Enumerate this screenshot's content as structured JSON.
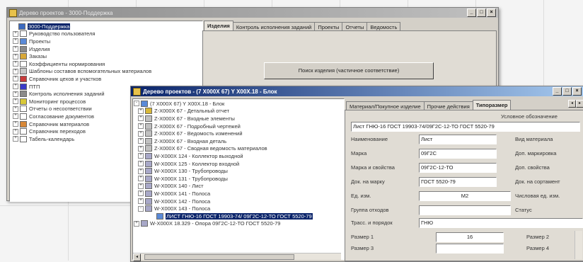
{
  "window1": {
    "title": "Дерево проектов - 3000-Поддержка",
    "buttons": [
      "_",
      "□",
      "×"
    ],
    "tree": [
      {
        "label": "3000-Поддержка",
        "exp": "",
        "icon_color": "#3c6ac0",
        "selected": true
      },
      {
        "label": "Руководство пользователя",
        "exp": "+",
        "icon_color": "#ffffff"
      },
      {
        "label": "Проекты",
        "exp": "+",
        "icon_color": "#5a8ad8"
      },
      {
        "label": "Изделия",
        "exp": "+",
        "icon_color": "#8a8a8a"
      },
      {
        "label": "Заказы",
        "exp": "+",
        "icon_color": "#d8a838"
      },
      {
        "label": "Коэффициенты нормирования",
        "exp": "+",
        "icon_color": "#ffffff"
      },
      {
        "label": "Шаблоны составов вспомогательных материалов",
        "exp": "+",
        "icon_color": "#c8c8c8"
      },
      {
        "label": "Справочник цехов и участков",
        "exp": "+",
        "icon_color": "#c83a3a"
      },
      {
        "label": "ПТП",
        "exp": "+",
        "icon_color": "#3a3ac8"
      },
      {
        "label": "Контроль исполнения заданий",
        "exp": "+",
        "icon_color": "#8a8a8a"
      },
      {
        "label": "Мониторинг процессов",
        "exp": "+",
        "icon_color": "#d8c838"
      },
      {
        "label": "Отчеты о несоответствии",
        "exp": "+",
        "icon_color": "#ffffff"
      },
      {
        "label": "Согласование документов",
        "exp": "+",
        "icon_color": "#ffffff"
      },
      {
        "label": "Справочник материалов",
        "exp": "+",
        "icon_color": "#d88838"
      },
      {
        "label": "Справочник переходов",
        "exp": "+",
        "icon_color": "#ffffff"
      },
      {
        "label": "Табель-календарь",
        "exp": "+",
        "icon_color": "#ffffff"
      }
    ],
    "tabs": [
      {
        "label": "Изделия",
        "active": true
      },
      {
        "label": "Контроль исполнения заданий",
        "active": false
      },
      {
        "label": "Проекты",
        "active": false
      },
      {
        "label": "Отчеты",
        "active": false
      },
      {
        "label": "Ведомость",
        "active": false
      }
    ],
    "main_button": "Поиск изделия (частичное соответствие)"
  },
  "window2": {
    "title": "Дерево проектов - (7 X000X 67) Y X00X.18 - Блок",
    "buttons": [
      "_",
      "□",
      "×"
    ],
    "tree": [
      {
        "label": "(7 X000X 67) Y X00X.18 - Блок",
        "exp": "-",
        "icon_color": "#5a8ad8"
      },
      {
        "label": "Z-X000X 67 - Детальный отчет",
        "exp": "+",
        "icon_color": "#d8b838"
      },
      {
        "label": "Z-X000X 67 - Входные элементы",
        "exp": "+",
        "icon_color": "#c0c0c0"
      },
      {
        "label": "Z-X000X 67 - Подробный чертежей",
        "exp": "+",
        "icon_color": "#c0c0c0"
      },
      {
        "label": "Z-X000X 67 - Ведомость изменений",
        "exp": "+",
        "icon_color": "#c0c0c0"
      },
      {
        "label": "Z-X000X 67 - Входная деталь",
        "exp": "+",
        "icon_color": "#c0c0c0"
      },
      {
        "label": "Z-X000X 67 - Сводная ведомость материалов",
        "exp": "+",
        "icon_color": "#c0c0c0"
      },
      {
        "label": "W-X000X 124 - Коллектор выходной",
        "exp": "+",
        "icon_color": "#a8a8c8"
      },
      {
        "label": "W-X000X 125 - Коллектор входной",
        "exp": "+",
        "icon_color": "#a8a8c8"
      },
      {
        "label": "W-X000X 130 - Трубопроводы",
        "exp": "+",
        "icon_color": "#a8a8c8"
      },
      {
        "label": "W-X000X 131 - Трубопроводы",
        "exp": "+",
        "icon_color": "#a8a8c8"
      },
      {
        "label": "W-X000X 140 - Лист",
        "exp": "+",
        "icon_color": "#a8a8c8"
      },
      {
        "label": "W-X000X 141 - Полоса",
        "exp": "+",
        "icon_color": "#a8a8c8"
      },
      {
        "label": "W-X000X 142 - Полоса",
        "exp": "+",
        "icon_color": "#a8a8c8"
      },
      {
        "label": "W-X000X 143 - Полоса",
        "exp": "-",
        "icon_color": "#a8a8c8"
      },
      {
        "label": "ЛИСТ ГНЮ-16 ГОСТ 19903-74/ 09Г2С-12-ТО ГОСТ 5520-79",
        "exp": "",
        "icon_color": "#5a8ad8",
        "selected": true
      },
      {
        "label": "W-X000X 18.329 - Опора 09Г2С-12-ТО ГОСТ 5520-79",
        "exp": "+",
        "icon_color": "#a8a8c8"
      }
    ],
    "tabs": [
      {
        "label": "Материал/Покупное изделие",
        "active": false
      },
      {
        "label": "Прочие действия",
        "active": false
      },
      {
        "label": "Типоразмер",
        "active": true
      }
    ],
    "form": {
      "header_label": "Условное обозначение",
      "full_designation": "Лист ГНЮ-16 ГОСТ 19903-74/09Г2С-12-ТО ГОСТ 5520-79",
      "name_label": "Наименование",
      "name_value": "Лист",
      "name_side": "Вид материала",
      "brand_label": "Марка",
      "brand_value": "09Г2С",
      "brand_side": "Доп. маркировка",
      "brandprop_label": "Марка и свойства",
      "brandprop_value": "09Г2С-12-ТО",
      "brandprop_side": "Доп. свойства",
      "doc_label": "Док. на марку",
      "doc_value": "ГОСТ 5520-79",
      "doc_side": "Док. на сортамент",
      "unit_label": "Ед. изм.",
      "unit_value": "М2",
      "unit_side": "Числовая ед. изм.",
      "group_label": "Группа отходов",
      "group_value": "",
      "group_side": "Статус",
      "sort_label": "Трасс. и порядок",
      "sort_value": "ГНЮ",
      "size1_label": "Размер 1",
      "size1_value": "16",
      "size2_label": "Размер 2",
      "size3_label": "Размер 3",
      "size4_label": "Размер 4"
    }
  }
}
